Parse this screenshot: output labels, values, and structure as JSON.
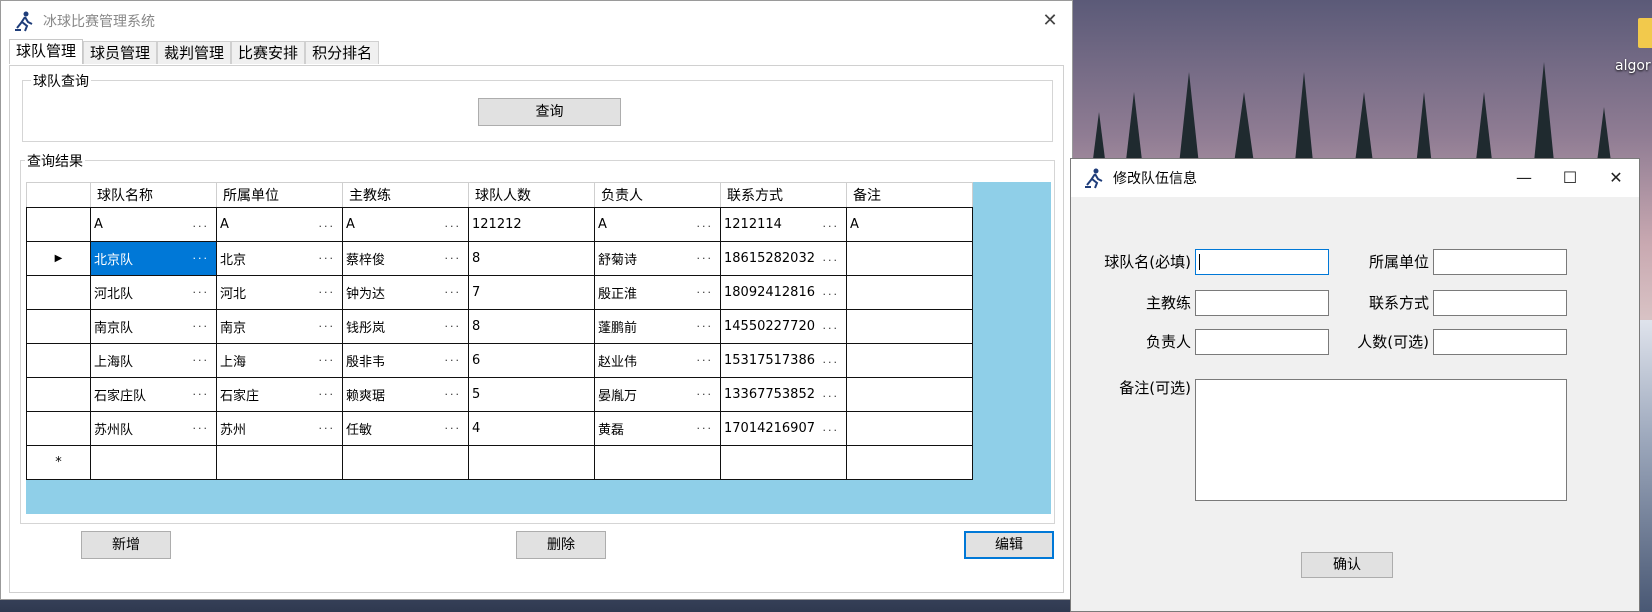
{
  "main_window": {
    "title": "冰球比赛管理系统",
    "tabs": [
      "球队管理",
      "球员管理",
      "裁判管理",
      "比赛安排",
      "积分排名"
    ],
    "query_group_label": "球队查询",
    "query_button": "查询",
    "results_group_label": "查询结果",
    "columns": [
      "球队名称",
      "所属单位",
      "主教练",
      "球队人数",
      "负责人",
      "联系方式",
      "备注"
    ],
    "rows": [
      [
        "A",
        "A",
        "A",
        "121212",
        "A",
        "1212114",
        "A"
      ],
      [
        "北京队",
        "北京",
        "蔡梓俊",
        "8",
        "舒菊诗",
        "18615282032",
        ""
      ],
      [
        "河北队",
        "河北",
        "钟为达",
        "7",
        "殷正淮",
        "18092412816",
        ""
      ],
      [
        "南京队",
        "南京",
        "钱彤岚",
        "8",
        "蓬鹏前",
        "14550227720",
        ""
      ],
      [
        "上海队",
        "上海",
        "殷非韦",
        "6",
        "赵业伟",
        "15317517386",
        ""
      ],
      [
        "石家庄队",
        "石家庄",
        "赖爽琚",
        "5",
        "晏胤万",
        "13367753852",
        ""
      ],
      [
        "苏州队",
        "苏州",
        "任敏",
        "4",
        "黄磊",
        "17014216907",
        ""
      ]
    ],
    "ellipsis": "...",
    "current_row_marker": "▶",
    "new_row_marker": "*",
    "buttons": {
      "add": "新增",
      "delete": "删除",
      "edit": "编辑"
    }
  },
  "edit_window": {
    "title": "修改队伍信息",
    "labels": {
      "team_name": "球队名(必填)",
      "unit": "所属单位",
      "coach": "主教练",
      "contact": "联系方式",
      "manager": "负责人",
      "count": "人数(可选)",
      "remark": "备注(可选)"
    },
    "confirm_button": "确认",
    "minimize": "—",
    "maximize": "☐",
    "close": "✕"
  },
  "desktop": {
    "file_label": "algor"
  }
}
